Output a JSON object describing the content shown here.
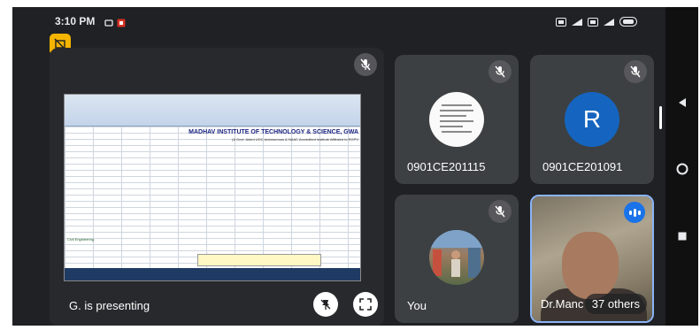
{
  "status_bar": {
    "time": "3:10 PM"
  },
  "presentation": {
    "presenting_label": "G. is presenting",
    "sheet": {
      "title": "MADHAV INSTITUTE OF TECHNOLOGY & SCIENCE, GWA",
      "subtitle": "(A Govt. Aided UGC Autonomous & NAAC Accredited Institute Affiliated to RGPV",
      "department_label": "Civil Engineering"
    }
  },
  "participants": [
    {
      "name": "0901CE201115",
      "avatar_type": "document"
    },
    {
      "name": "0901CE201091",
      "avatar_letter": "R",
      "avatar_color": "#1565c0"
    },
    {
      "name": "You",
      "avatar_type": "photo"
    },
    {
      "name": "Dr.Manc",
      "others_label": "37 others"
    }
  ],
  "colors": {
    "meet_background": "#202124",
    "tile_background": "#3c4043",
    "accent_blue": "#1a73e8",
    "active_speaker_border": "#8ab4f8",
    "badge_yellow": "#f4b400"
  },
  "icons": {
    "mute": "mic-off-icon",
    "fullscreen": "fullscreen-icon",
    "speaking": "speaking-indicator-icon",
    "back": "back-triangle-icon",
    "home": "home-circle-icon",
    "recents": "recents-square-icon"
  }
}
